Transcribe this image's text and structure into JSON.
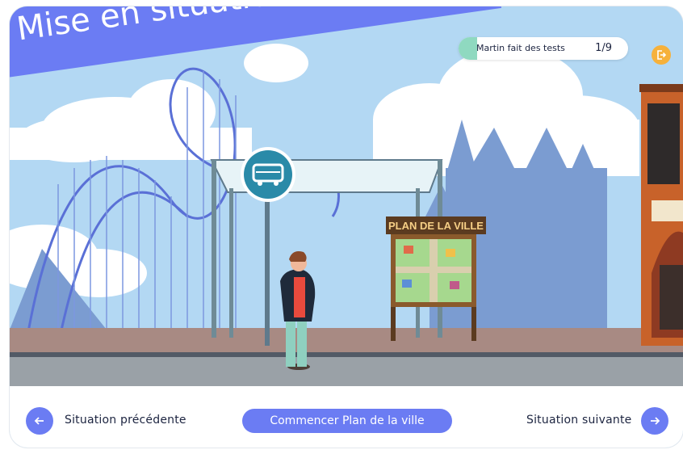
{
  "banner": {
    "title": "Mise en situation optio"
  },
  "progress": {
    "name": "Martin fait des tests",
    "count": "1/9",
    "fraction": 0.11
  },
  "scene": {
    "sign_title": "PLAN DE LA VILLE"
  },
  "footer": {
    "prev_label": "Situation précédente",
    "start_label": "Commencer Plan de la ville",
    "next_label": "Situation suivante"
  },
  "colors": {
    "accent": "#6b7cf3",
    "exit": "#f6b13b",
    "progress_fill": "#8fd9c0",
    "sky": "#b3d8f3"
  },
  "icons": {
    "prev": "arrow-left-icon",
    "next": "arrow-right-icon",
    "exit": "exit-icon",
    "bus": "bus-icon"
  }
}
